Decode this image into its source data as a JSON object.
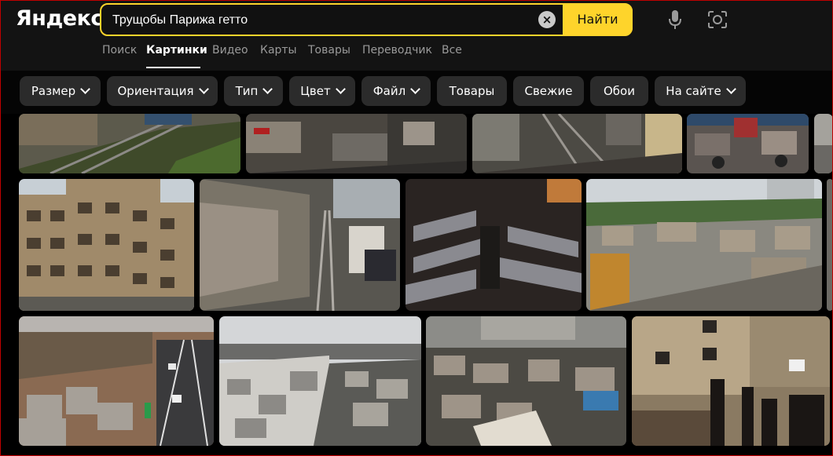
{
  "header": {
    "logo": "Яндекс",
    "search": {
      "value": "Трущобы Парижа гетто",
      "clear_icon": "close-icon",
      "find_label": "Найти"
    },
    "mic_icon": "microphone-icon",
    "camera_icon": "camera-search-icon"
  },
  "tabs": [
    {
      "label": "Поиск",
      "active": false
    },
    {
      "label": "Картинки",
      "active": true
    },
    {
      "label": "Видео",
      "active": false
    },
    {
      "label": "Карты",
      "active": false
    },
    {
      "label": "Товары",
      "active": false
    },
    {
      "label": "Переводчик",
      "active": false
    },
    {
      "label": "Все",
      "active": false
    }
  ],
  "filters": [
    {
      "label": "Размер",
      "dropdown": true
    },
    {
      "label": "Ориентация",
      "dropdown": true
    },
    {
      "label": "Тип",
      "dropdown": true
    },
    {
      "label": "Цвет",
      "dropdown": true
    },
    {
      "label": "Файл",
      "dropdown": true
    },
    {
      "label": "Товары",
      "dropdown": false
    },
    {
      "label": "Свежие",
      "dropdown": false
    },
    {
      "label": "Обои",
      "dropdown": false
    },
    {
      "label": "На сайте",
      "dropdown": true
    }
  ],
  "colors": {
    "accent": "#fed42b",
    "background": "#000000",
    "chip": "#2b2b2b",
    "muted_text": "#9a9a9a"
  },
  "images": [
    {
      "subject": "railway tracks slum with debris and greenery"
    },
    {
      "subject": "shacks with trash along tracks"
    },
    {
      "subject": "shanty alley beside rail tracks"
    },
    {
      "subject": "market with burnt cars"
    },
    {
      "subject": "old decaying apartment building"
    },
    {
      "subject": "tarp shacks along rail tracks"
    },
    {
      "subject": "tunnel filled with makeshift shelters"
    },
    {
      "subject": "shanty town with rubble"
    },
    {
      "subject": "camp beside road with cars"
    },
    {
      "subject": "huge trash pile and shacks"
    },
    {
      "subject": "shanty town along rail trench"
    },
    {
      "subject": "courtyard market with people"
    }
  ]
}
